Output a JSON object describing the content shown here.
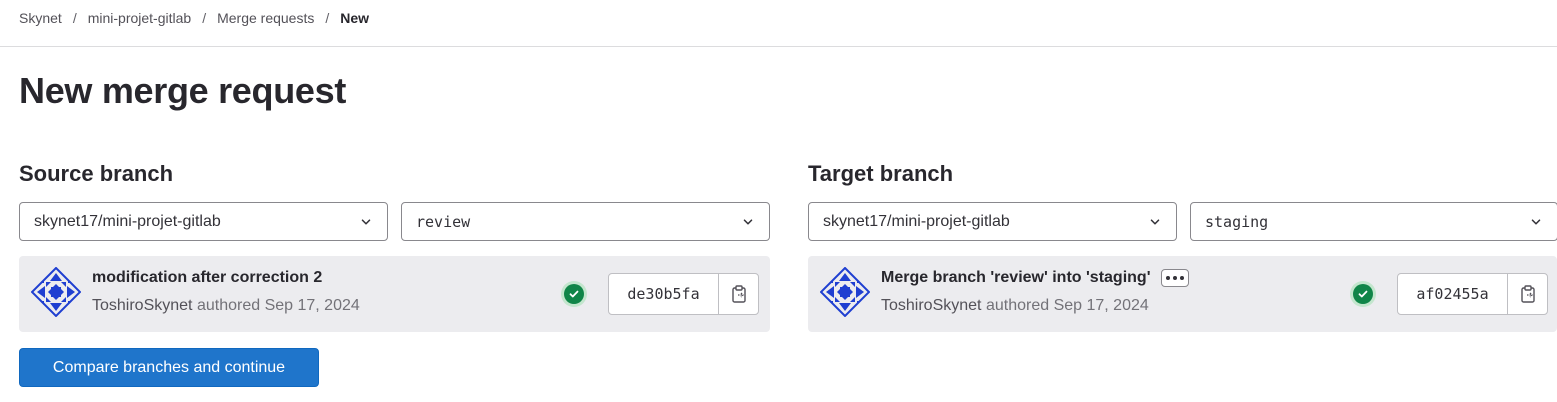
{
  "breadcrumb": [
    {
      "label": "Skynet"
    },
    {
      "label": "mini-projet-gitlab"
    },
    {
      "label": "Merge requests"
    },
    {
      "label": "New"
    }
  ],
  "breadcrumb_separator": "/",
  "page_title": "New merge request",
  "source": {
    "heading": "Source branch",
    "project": "skynet17/mini-projet-gitlab",
    "branch": "review",
    "commit": {
      "title": "modification after correction 2",
      "author": "ToshiroSkynet",
      "meta": "authored Sep 17, 2024",
      "sha": "de30b5fa",
      "status": "passed",
      "status_color": "#108548"
    }
  },
  "target": {
    "heading": "Target branch",
    "project": "skynet17/mini-projet-gitlab",
    "branch": "staging",
    "commit": {
      "title": "Merge branch 'review' into 'staging'",
      "author": "ToshiroSkynet",
      "meta": "authored Sep 17, 2024",
      "sha": "af02455a",
      "status": "passed",
      "status_color": "#108548"
    }
  },
  "compare_button": "Compare branches and continue",
  "colors": {
    "primary": "#1f75cb",
    "success": "#108548",
    "avatar": "#1f3fd1"
  },
  "icons": {
    "dropdown": "chevron-down-icon",
    "status": "check-circle-icon",
    "copy": "copy-to-clipboard-icon",
    "more": "ellipsis-icon"
  }
}
